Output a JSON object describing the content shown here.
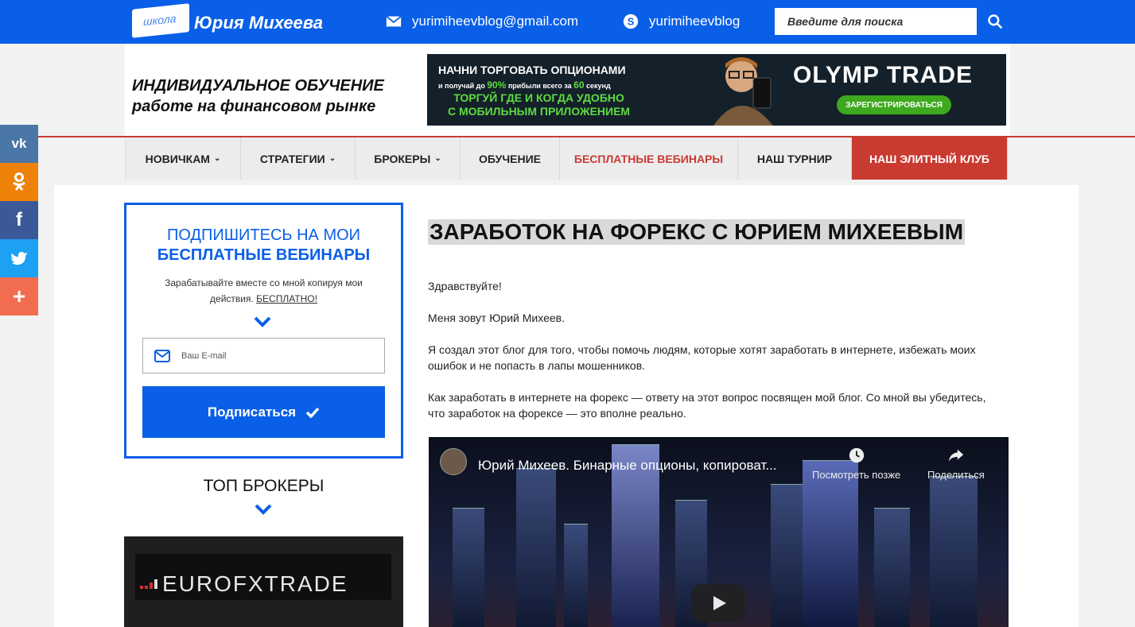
{
  "topbar": {
    "logo_small": "школа",
    "logo_name": "Юрия Михеева",
    "email": "yurimiheevblog@gmail.com",
    "skype": "yurimiheevblog",
    "search_placeholder": "Введите для поиска",
    "accent": "#0a5fe8"
  },
  "header": {
    "tagline_1": "ИНДИВИДУАЛЬНОЕ ОБУЧЕНИЕ",
    "tagline_2": "работе на финансовом рынке",
    "banner": {
      "line1": "НАЧНИ ТОРГОВАТЬ ОПЦИОНАМИ",
      "line2_a": "и получай до ",
      "line2_b": "90%",
      "line2_c": " прибыли всего за ",
      "line2_d": "60",
      "line2_e": " секунд",
      "line3": "ТОРГУЙ ГДЕ И КОГДА УДОБНО",
      "line4": "С МОБИЛЬНЫМ ПРИЛОЖЕНИЕМ",
      "brand": "OLYMP TRADE",
      "cta": "ЗАРЕГИСТРИРОВАТЬСЯ"
    }
  },
  "nav": {
    "items": [
      {
        "label": "НОВИЧКАМ",
        "dropdown": "⌄"
      },
      {
        "label": "СТРАТЕГИИ",
        "dropdown": "⌄"
      },
      {
        "label": "БРОКЕРЫ",
        "dropdown": "⌄"
      },
      {
        "label": "ОБУЧЕНИЕ"
      },
      {
        "label": "БЕСПЛАТНЫЕ ВЕБИНАРЫ"
      },
      {
        "label": "НАШ ТУРНИР"
      },
      {
        "label": "НАШ ЭЛИТНЫЙ КЛУБ"
      }
    ],
    "highlight_color": "#c93a31"
  },
  "social": {
    "vk": "vk",
    "ok": "ok",
    "fb": "f",
    "tw": "twitter",
    "more": "+",
    "colors": [
      "#4a76a8",
      "#ee8208",
      "#3b5998",
      "#1da1f2",
      "#f26d4f"
    ]
  },
  "subscribe": {
    "title_1": "ПОДПИШИТЕСЬ НА МОИ",
    "title_2": "БЕСПЛАТНЫЕ ВЕБИНАРЫ",
    "text": "Зарабатывайте вместе со мной копируя мои действия. ",
    "text_link": "БЕСПЛАТНО!",
    "email_placeholder": "Ваш E-mail",
    "button": "Подписаться"
  },
  "sidebar": {
    "top_brokers": "ТОП БРОКЕРЫ",
    "broker_name": "EUROFXTRADE"
  },
  "main": {
    "title": "ЗАРАБОТОК НА ФОРЕКС С ЮРИЕМ МИХЕЕВЫМ",
    "paragraphs": [
      "Здравствуйте!",
      "Меня зовут Юрий Михеев.",
      "Я создал этот блог для того, чтобы помочь людям, которые хотят заработать в интернете, избежать моих ошибок и не попасть в лапы мошенников.",
      "Как заработать в интернете на форекс — ответу на этот вопрос посвящен мой блог. Со мной вы убедитесь, что заработок на форексе — это вполне реально."
    ],
    "video": {
      "title": "Юрий Михеев. Бинарные опционы, копироват...",
      "watch_later": "Посмотреть позже",
      "share": "Поделиться"
    }
  }
}
